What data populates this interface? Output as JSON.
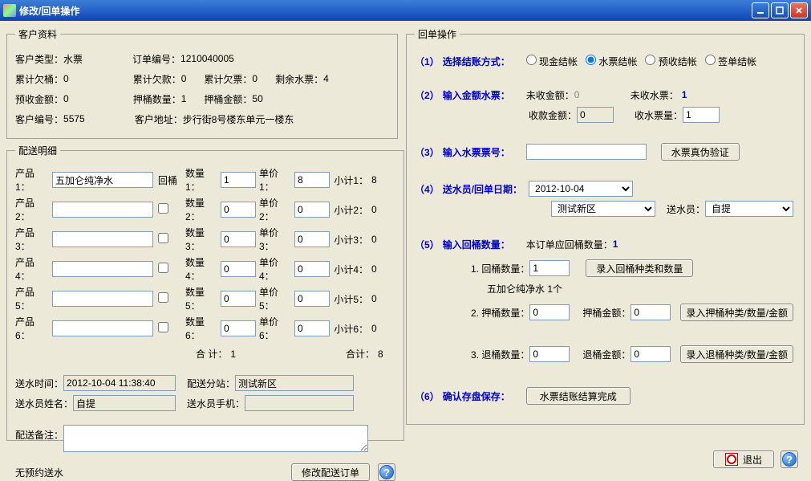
{
  "window": {
    "title": "修改/回单操作"
  },
  "customer": {
    "legend": "客户资料",
    "type_lbl": "客户类型：",
    "type_val": "水票",
    "order_lbl": "订单编号：",
    "order_val": "1210040005",
    "owe_bucket_lbl": "累计欠桶：",
    "owe_bucket_val": "0",
    "owe_money_lbl": "累计欠款：",
    "owe_money_val": "0",
    "owe_ticket_lbl": "累计欠票：",
    "owe_ticket_val": "0",
    "remain_ticket_lbl": "剩余水票：",
    "remain_ticket_val": "4",
    "prepay_lbl": "预收金额：",
    "prepay_val": "0",
    "deposit_qty_lbl": "押桶数量：",
    "deposit_qty_val": "1",
    "deposit_amt_lbl": "押桶金额：",
    "deposit_amt_val": "50",
    "cust_no_lbl": "客户编号：",
    "cust_no_val": "5575",
    "cust_addr_lbl": "客户地址：",
    "cust_addr_val": "步行街8号楼东单元一楼东"
  },
  "delivery": {
    "legend": "配送明细",
    "return_bucket_lbl": "回桶",
    "products": [
      {
        "lbl": "产品1：",
        "name": "五加仑纯净水",
        "qty_lbl": "数量1：",
        "qty": "1",
        "price_lbl": "单价1：",
        "price": "8",
        "sub_lbl": "小计1：",
        "sub": "8",
        "cb": true
      },
      {
        "lbl": "产品2：",
        "name": "",
        "qty_lbl": "数量2：",
        "qty": "0",
        "price_lbl": "单价2：",
        "price": "0",
        "sub_lbl": "小计2：",
        "sub": "0",
        "cb": false
      },
      {
        "lbl": "产品3：",
        "name": "",
        "qty_lbl": "数量3：",
        "qty": "0",
        "price_lbl": "单价3：",
        "price": "0",
        "sub_lbl": "小计3：",
        "sub": "0",
        "cb": false
      },
      {
        "lbl": "产品4：",
        "name": "",
        "qty_lbl": "数量4：",
        "qty": "0",
        "price_lbl": "单价4：",
        "price": "0",
        "sub_lbl": "小计4：",
        "sub": "0",
        "cb": false
      },
      {
        "lbl": "产品5：",
        "name": "",
        "qty_lbl": "数量5：",
        "qty": "0",
        "price_lbl": "单价5：",
        "price": "0",
        "sub_lbl": "小计5：",
        "sub": "0",
        "cb": false
      },
      {
        "lbl": "产品6：",
        "name": "",
        "qty_lbl": "数量6：",
        "qty": "0",
        "price_lbl": "单价6：",
        "price": "0",
        "sub_lbl": "小计6：",
        "sub": "0",
        "cb": false
      }
    ],
    "totals_lbl": "合  计：",
    "totals_qty": "1",
    "totals_amt_lbl": "合计：",
    "totals_amt": "8",
    "time_lbl": "送水时间：",
    "time_val": "2012-10-04 11:38:40",
    "station_lbl": "配送分站：",
    "station_val": "测试新区",
    "courier_name_lbl": "送水员姓名：",
    "courier_name_val": "自提",
    "courier_phone_lbl": "送水员手机：",
    "courier_phone_val": "",
    "remark_lbl": "配送备注：",
    "remark_val": "",
    "no_appt": "无预约送水",
    "modify_btn": "修改配送订单"
  },
  "receipt": {
    "legend": "回单操作",
    "s1_no": "（1）",
    "s1_lbl": "选择结账方式：",
    "pay_options": [
      "现金结帐",
      "水票结帐",
      "预收结帐",
      "签单结帐"
    ],
    "pay_selected": 1,
    "s2_no": "（2）",
    "s2_lbl": "输入金额水票：",
    "unpaid_amt_lbl": "未收金额：",
    "unpaid_amt_val": "0",
    "unpaid_ticket_lbl": "未收水票：",
    "unpaid_ticket_val": "1",
    "recv_amt_lbl": "收款金额：",
    "recv_amt_val": "0",
    "recv_ticket_lbl": "收水票量：",
    "recv_ticket_val": "1",
    "s3_no": "（3）",
    "s3_lbl": "输入水票票号：",
    "ticket_no_val": "",
    "verify_btn": "水票真伪验证",
    "s4_no": "（4）",
    "s4_lbl": "送水员/回单日期：",
    "date_val": "2012-10-04",
    "station_sel": "测试新区",
    "courier_lbl": "送水员：",
    "courier_sel": "自提",
    "s5_no": "（5）",
    "s5_lbl": "输入回桶数量：",
    "order_return_lbl": "本订单应回桶数量：",
    "order_return_val": "1",
    "r1_lbl": "1. 回桶数量：",
    "r1_val": "1",
    "r1_btn": "录入回桶种类和数量",
    "r1_detail": "五加仑纯净水 1个",
    "r2_lbl": "2. 押桶数量：",
    "r2_val": "0",
    "r2_amt_lbl": "押桶金额：",
    "r2_amt_val": "0",
    "r2_btn": "录入押桶种类/数量/金额",
    "r3_lbl": "3. 退桶数量：",
    "r3_val": "0",
    "r3_amt_lbl": "退桶金额：",
    "r3_amt_val": "0",
    "r3_btn": "录入退桶种类/数量/金额",
    "s6_no": "（6）",
    "s6_lbl": "确认存盘保存：",
    "s6_btn": "水票结账结算完成"
  },
  "footer": {
    "exit": "退出"
  }
}
